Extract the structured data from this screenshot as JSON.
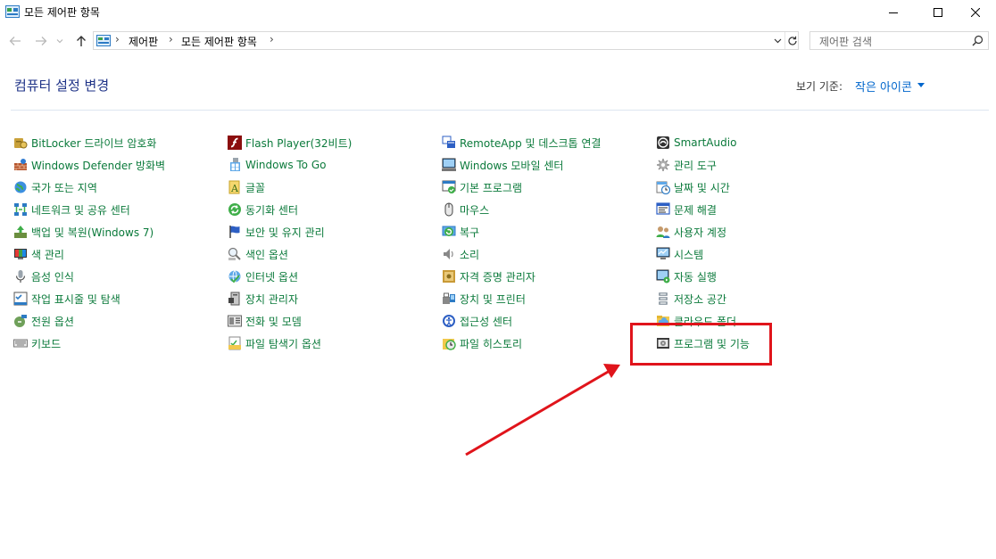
{
  "window": {
    "title": "모든 제어판 항목",
    "controls": {
      "minimize": "minimize",
      "maximize": "maximize",
      "close": "close"
    }
  },
  "address": {
    "crumbs": [
      "제어판",
      "모든 제어판 항목"
    ],
    "search_placeholder": "제어판 검색"
  },
  "header": {
    "title": "컴퓨터 설정 변경",
    "view_by_label": "보기 기준:",
    "view_by_value": "작은 아이콘"
  },
  "columns": [
    [
      {
        "label": "BitLocker 드라이브 암호화",
        "icon": "bitlocker-icon"
      },
      {
        "label": "Windows Defender 방화벽",
        "icon": "firewall-icon"
      },
      {
        "label": "국가 또는 지역",
        "icon": "region-icon"
      },
      {
        "label": "네트워크 및 공유 센터",
        "icon": "network-icon"
      },
      {
        "label": "백업 및 복원(Windows 7)",
        "icon": "backup-icon"
      },
      {
        "label": "색 관리",
        "icon": "color-management-icon"
      },
      {
        "label": "음성 인식",
        "icon": "speech-icon"
      },
      {
        "label": "작업 표시줄 및 탐색",
        "icon": "taskbar-icon"
      },
      {
        "label": "전원 옵션",
        "icon": "power-icon"
      },
      {
        "label": "키보드",
        "icon": "keyboard-icon"
      }
    ],
    [
      {
        "label": "Flash Player(32비트)",
        "icon": "flash-icon"
      },
      {
        "label": "Windows To Go",
        "icon": "windows-to-go-icon"
      },
      {
        "label": "글꼴",
        "icon": "font-icon"
      },
      {
        "label": "동기화 센터",
        "icon": "sync-icon"
      },
      {
        "label": "보안 및 유지 관리",
        "icon": "flag-icon"
      },
      {
        "label": "색인 옵션",
        "icon": "indexing-icon"
      },
      {
        "label": "인터넷 옵션",
        "icon": "internet-icon"
      },
      {
        "label": "장치 관리자",
        "icon": "device-manager-icon"
      },
      {
        "label": "전화 및 모뎀",
        "icon": "phone-icon"
      },
      {
        "label": "파일 탐색기 옵션",
        "icon": "folder-options-icon"
      }
    ],
    [
      {
        "label": "RemoteApp 및 데스크톱 연결",
        "icon": "remoteapp-icon"
      },
      {
        "label": "Windows 모바일 센터",
        "icon": "mobility-icon"
      },
      {
        "label": "기본 프로그램",
        "icon": "default-programs-icon"
      },
      {
        "label": "마우스",
        "icon": "mouse-icon"
      },
      {
        "label": "복구",
        "icon": "recovery-icon"
      },
      {
        "label": "소리",
        "icon": "sound-icon"
      },
      {
        "label": "자격 증명 관리자",
        "icon": "credential-icon"
      },
      {
        "label": "장치 및 프린터",
        "icon": "printer-icon"
      },
      {
        "label": "접근성 센터",
        "icon": "accessibility-icon"
      },
      {
        "label": "파일 히스토리",
        "icon": "file-history-icon"
      }
    ],
    [
      {
        "label": "SmartAudio",
        "icon": "smartaudio-icon"
      },
      {
        "label": "관리 도구",
        "icon": "admin-tools-icon"
      },
      {
        "label": "날짜 및 시간",
        "icon": "clock-icon"
      },
      {
        "label": "문제 해결",
        "icon": "troubleshoot-icon"
      },
      {
        "label": "사용자 계정",
        "icon": "users-icon"
      },
      {
        "label": "시스템",
        "icon": "system-icon"
      },
      {
        "label": "자동 실행",
        "icon": "autoplay-icon"
      },
      {
        "label": "저장소 공간",
        "icon": "storage-icon"
      },
      {
        "label": "클라우드 폴더",
        "icon": "cloud-folder-icon"
      },
      {
        "label": "프로그램 및 기능",
        "icon": "programs-icon"
      }
    ]
  ],
  "colors": {
    "link_green": "#0b7a3b",
    "title_blue": "#1e3287",
    "link_blue": "#0066cc",
    "annotation_red": "#e0141b"
  }
}
